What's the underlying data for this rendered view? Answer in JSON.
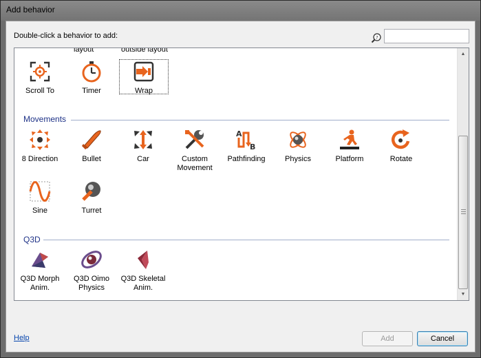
{
  "window": {
    "title": "Add behavior"
  },
  "instruction": "Double-click a behavior to add:",
  "search": {
    "placeholder": "",
    "value": ""
  },
  "cut_labels": [
    "layout",
    "outside layout"
  ],
  "top_items": [
    {
      "label": "Scroll To",
      "icon": "scroll-to-icon"
    },
    {
      "label": "Timer",
      "icon": "timer-icon"
    },
    {
      "label": "Wrap",
      "icon": "wrap-icon",
      "selected": true
    }
  ],
  "categories": [
    {
      "name": "Movements",
      "items": [
        {
          "label": "8 Direction",
          "icon": "eight-direction-icon"
        },
        {
          "label": "Bullet",
          "icon": "bullet-icon"
        },
        {
          "label": "Car",
          "icon": "car-icon"
        },
        {
          "label": "Custom Movement",
          "icon": "custom-movement-icon"
        },
        {
          "label": "Pathfinding",
          "icon": "pathfinding-icon"
        },
        {
          "label": "Physics",
          "icon": "physics-icon"
        },
        {
          "label": "Platform",
          "icon": "platform-icon"
        },
        {
          "label": "Rotate",
          "icon": "rotate-icon"
        },
        {
          "label": "Sine",
          "icon": "sine-icon"
        },
        {
          "label": "Turret",
          "icon": "turret-icon"
        }
      ]
    },
    {
      "name": "Q3D",
      "items": [
        {
          "label": "Q3D Morph Anim.",
          "icon": "q3d-morph-icon"
        },
        {
          "label": "Q3D Oimo Physics",
          "icon": "q3d-oimo-icon"
        },
        {
          "label": "Q3D Skeletal Anim.",
          "icon": "q3d-skeletal-icon"
        }
      ]
    }
  ],
  "footer": {
    "help": "Help",
    "add": "Add",
    "cancel": "Cancel"
  },
  "colors": {
    "accent": "#e8641e",
    "category": "#1e3287"
  }
}
